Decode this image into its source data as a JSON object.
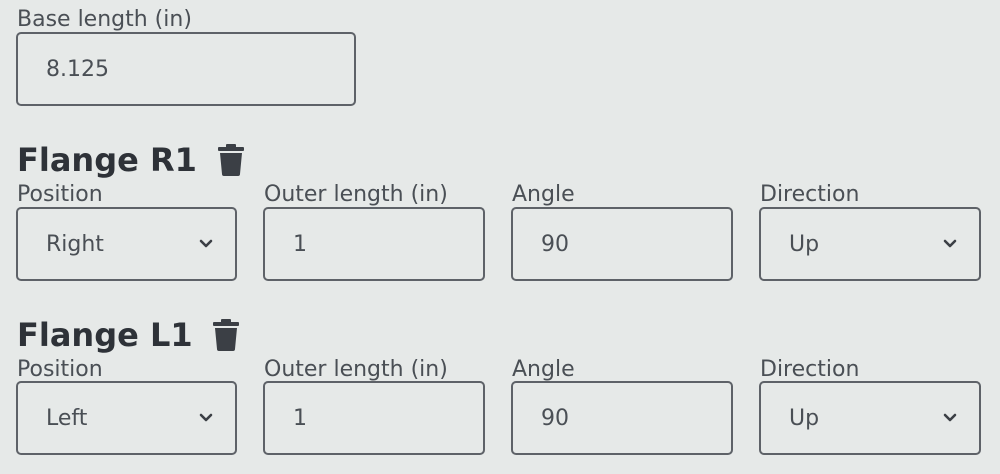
{
  "base": {
    "label": "Base length (in)",
    "value": "8.125"
  },
  "flanges": [
    {
      "title": "Flange R1",
      "position_label": "Position",
      "position_value": "Right",
      "outer_length_label": "Outer length (in)",
      "outer_length_value": "1",
      "angle_label": "Angle",
      "angle_value": "90",
      "direction_label": "Direction",
      "direction_value": "Up"
    },
    {
      "title": "Flange L1",
      "position_label": "Position",
      "position_value": "Left",
      "outer_length_label": "Outer length (in)",
      "outer_length_value": "1",
      "angle_label": "Angle",
      "angle_value": "90",
      "direction_label": "Direction",
      "direction_value": "Up"
    }
  ],
  "icons": {
    "delete": "trash-icon",
    "dropdown": "chevron-down-icon"
  },
  "colors": {
    "background": "#e6e9e8",
    "border": "#5e6268",
    "heading": "#2e3238",
    "text": "#4a4f55"
  }
}
